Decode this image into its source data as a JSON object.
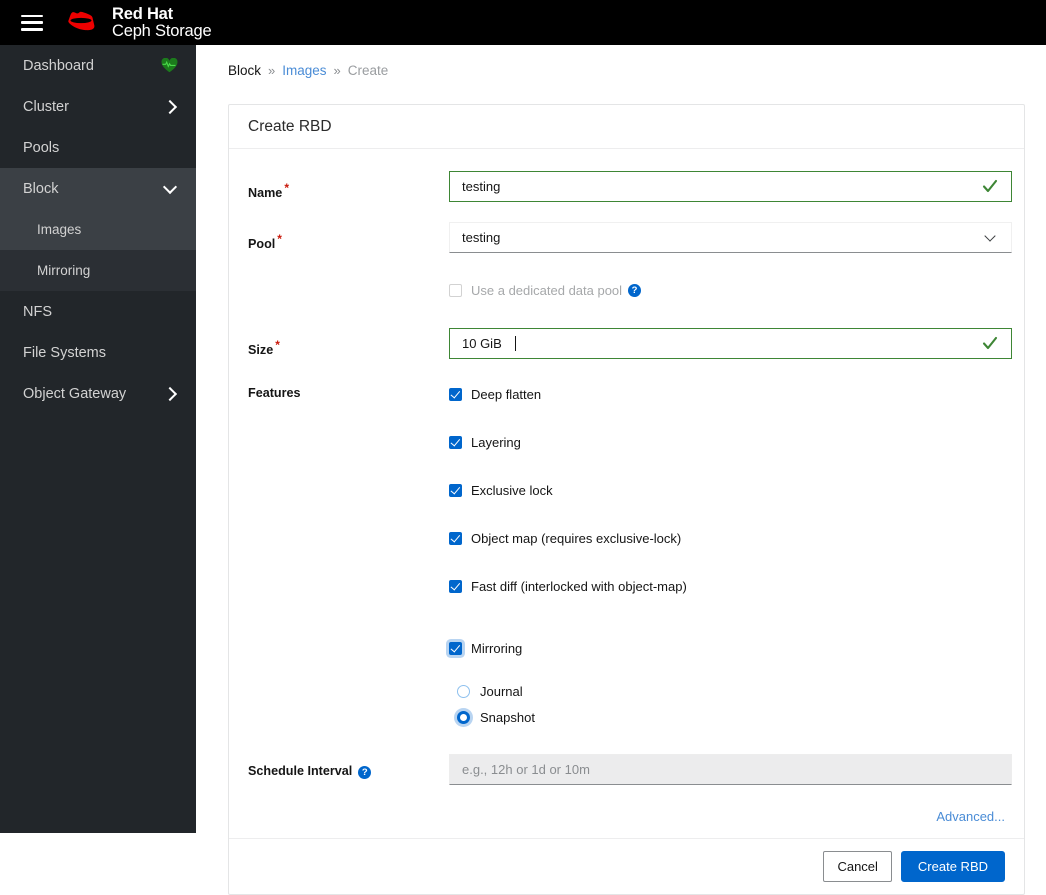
{
  "header": {
    "menu_icon": "hamburger-icon",
    "logo_icon": "red-hat-logo-icon",
    "brand_line1": "Red Hat",
    "brand_line2": "Ceph Storage"
  },
  "sidebar": {
    "items": [
      {
        "label": "Dashboard",
        "icon": "heartbeat-icon",
        "state": "normal"
      },
      {
        "label": "Cluster",
        "icon": "chevron-right-icon",
        "state": "normal"
      },
      {
        "label": "Pools",
        "icon": "",
        "state": "normal"
      },
      {
        "label": "Block",
        "icon": "chevron-down-icon",
        "state": "expanded"
      },
      {
        "label": "Images",
        "icon": "",
        "state": "sub-active"
      },
      {
        "label": "Mirroring",
        "icon": "",
        "state": "sub"
      },
      {
        "label": "NFS",
        "icon": "",
        "state": "normal"
      },
      {
        "label": "File Systems",
        "icon": "",
        "state": "normal"
      },
      {
        "label": "Object Gateway",
        "icon": "chevron-right-icon",
        "state": "normal"
      }
    ]
  },
  "breadcrumb": {
    "root": "Block",
    "sep": "»",
    "link": "Images",
    "current": "Create"
  },
  "card": {
    "title": "Create RBD",
    "fields": {
      "name": {
        "label": "Name",
        "required": "*",
        "value": "testing",
        "valid_icon": "check-icon"
      },
      "pool": {
        "label": "Pool",
        "required": "*",
        "value": "testing",
        "chevron": "chevron-down-icon"
      },
      "dedicated_pool": {
        "label": "Use a dedicated data pool",
        "checked": false,
        "disabled": true,
        "help": "?"
      },
      "size": {
        "label": "Size",
        "required": "*",
        "value": "10 GiB",
        "valid_icon": "check-icon"
      },
      "features": {
        "label": "Features",
        "items": [
          {
            "label": "Deep flatten",
            "checked": true
          },
          {
            "label": "Layering",
            "checked": true
          },
          {
            "label": "Exclusive lock",
            "checked": true
          },
          {
            "label": "Object map (requires exclusive-lock)",
            "checked": true
          },
          {
            "label": "Fast diff (interlocked with object-map)",
            "checked": true
          }
        ]
      },
      "mirroring": {
        "label": "Mirroring",
        "checked": true,
        "focused": true,
        "modes": [
          {
            "label": "Journal",
            "selected": false
          },
          {
            "label": "Snapshot",
            "selected": true
          }
        ]
      },
      "schedule_interval": {
        "label": "Schedule Interval",
        "help": "?",
        "value": "",
        "placeholder": "e.g., 12h or 1d or 10m",
        "disabled": true
      }
    },
    "advanced_link": "Advanced...",
    "footer": {
      "cancel": "Cancel",
      "submit": "Create RBD"
    }
  },
  "colors": {
    "brand_red": "#ee0000",
    "accent_blue": "#0066cc",
    "valid_green": "#3e8635",
    "required_red": "#c9190b",
    "sidebar_bg": "#22262a",
    "sidebar_active": "#3b4045",
    "link_blue": "#4a8cd6",
    "health_green": "#1c7b1c"
  }
}
